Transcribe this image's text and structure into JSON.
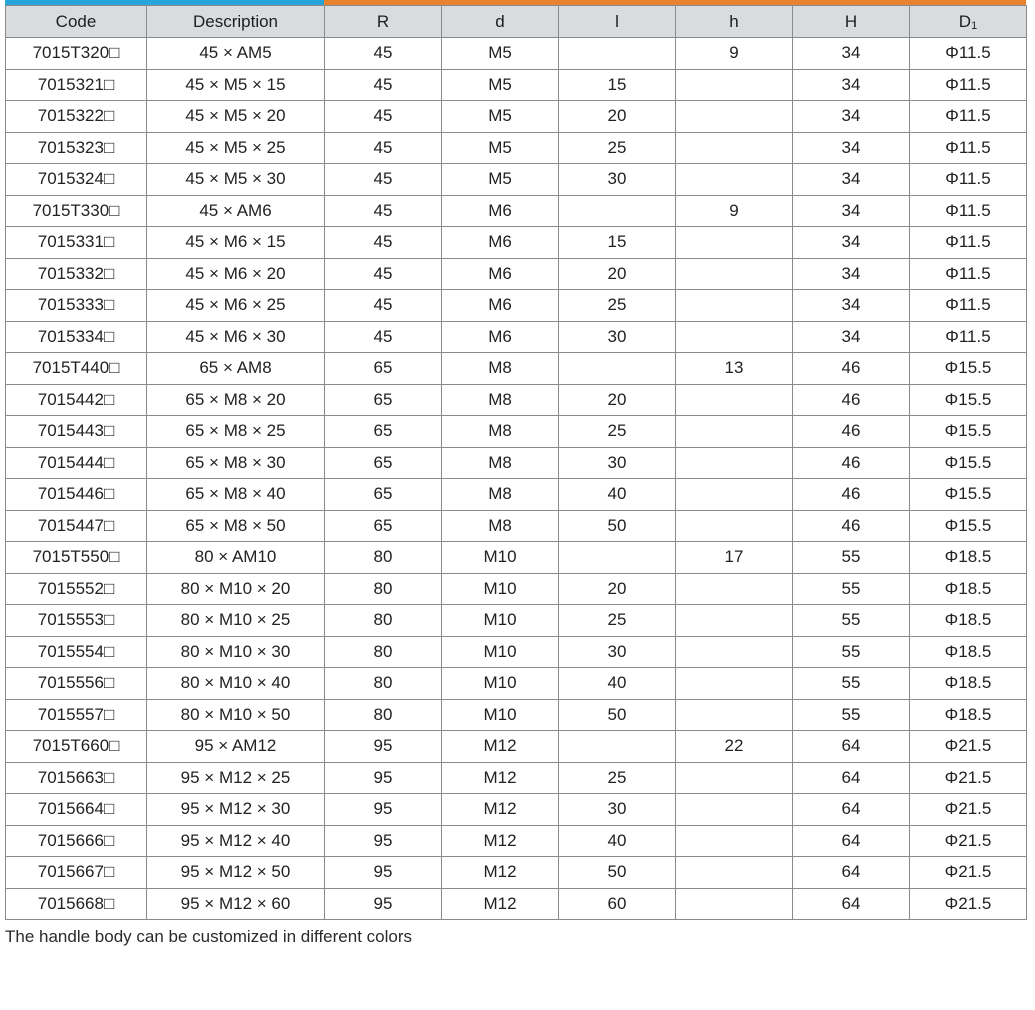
{
  "table": {
    "headers": [
      "Code",
      "Description",
      "R",
      "d",
      "l",
      "h",
      "H",
      "D"
    ],
    "header_subscript_d1": "1",
    "rows": [
      [
        "7015T320□",
        "45 × AM5",
        "45",
        "M5",
        "",
        "9",
        "34",
        "Φ11.5"
      ],
      [
        "7015321□",
        "45 × M5 × 15",
        "45",
        "M5",
        "15",
        "",
        "34",
        "Φ11.5"
      ],
      [
        "7015322□",
        "45 × M5 × 20",
        "45",
        "M5",
        "20",
        "",
        "34",
        "Φ11.5"
      ],
      [
        "7015323□",
        "45 × M5 × 25",
        "45",
        "M5",
        "25",
        "",
        "34",
        "Φ11.5"
      ],
      [
        "7015324□",
        "45 × M5 × 30",
        "45",
        "M5",
        "30",
        "",
        "34",
        "Φ11.5"
      ],
      [
        "7015T330□",
        "45 × AM6",
        "45",
        "M6",
        "",
        "9",
        "34",
        "Φ11.5"
      ],
      [
        "7015331□",
        "45 × M6 × 15",
        "45",
        "M6",
        "15",
        "",
        "34",
        "Φ11.5"
      ],
      [
        "7015332□",
        "45 × M6 × 20",
        "45",
        "M6",
        "20",
        "",
        "34",
        "Φ11.5"
      ],
      [
        "7015333□",
        "45 × M6 × 25",
        "45",
        "M6",
        "25",
        "",
        "34",
        "Φ11.5"
      ],
      [
        "7015334□",
        "45 × M6 × 30",
        "45",
        "M6",
        "30",
        "",
        "34",
        "Φ11.5"
      ],
      [
        "7015T440□",
        "65 × AM8",
        "65",
        "M8",
        "",
        "13",
        "46",
        "Φ15.5"
      ],
      [
        "7015442□",
        "65 × M8 × 20",
        "65",
        "M8",
        "20",
        "",
        "46",
        "Φ15.5"
      ],
      [
        "7015443□",
        "65 × M8 × 25",
        "65",
        "M8",
        "25",
        "",
        "46",
        "Φ15.5"
      ],
      [
        "7015444□",
        "65 × M8 × 30",
        "65",
        "M8",
        "30",
        "",
        "46",
        "Φ15.5"
      ],
      [
        "7015446□",
        "65 × M8 × 40",
        "65",
        "M8",
        "40",
        "",
        "46",
        "Φ15.5"
      ],
      [
        "7015447□",
        "65 × M8 × 50",
        "65",
        "M8",
        "50",
        "",
        "46",
        "Φ15.5"
      ],
      [
        "7015T550□",
        "80 × AM10",
        "80",
        "M10",
        "",
        "17",
        "55",
        "Φ18.5"
      ],
      [
        "7015552□",
        "80 × M10 × 20",
        "80",
        "M10",
        "20",
        "",
        "55",
        "Φ18.5"
      ],
      [
        "7015553□",
        "80 × M10 × 25",
        "80",
        "M10",
        "25",
        "",
        "55",
        "Φ18.5"
      ],
      [
        "7015554□",
        "80 × M10 × 30",
        "80",
        "M10",
        "30",
        "",
        "55",
        "Φ18.5"
      ],
      [
        "7015556□",
        "80 × M10 × 40",
        "80",
        "M10",
        "40",
        "",
        "55",
        "Φ18.5"
      ],
      [
        "7015557□",
        "80 × M10 × 50",
        "80",
        "M10",
        "50",
        "",
        "55",
        "Φ18.5"
      ],
      [
        "7015T660□",
        "95 × AM12",
        "95",
        "M12",
        "",
        "22",
        "64",
        "Φ21.5"
      ],
      [
        "7015663□",
        "95 × M12 × 25",
        "95",
        "M12",
        "25",
        "",
        "64",
        "Φ21.5"
      ],
      [
        "7015664□",
        "95 × M12 × 30",
        "95",
        "M12",
        "30",
        "",
        "64",
        "Φ21.5"
      ],
      [
        "7015666□",
        "95 × M12 × 40",
        "95",
        "M12",
        "40",
        "",
        "64",
        "Φ21.5"
      ],
      [
        "7015667□",
        "95 × M12 × 50",
        "95",
        "M12",
        "50",
        "",
        "64",
        "Φ21.5"
      ],
      [
        "7015668□",
        "95 × M12 × 60",
        "95",
        "M12",
        "60",
        "",
        "64",
        "Φ21.5"
      ]
    ]
  },
  "note": "The handle body can be customized in different colors",
  "colors": {
    "accent_blue": "#27a6de",
    "accent_orange": "#e8822f",
    "header_bg": "#d9dcdf",
    "border": "#8a8a8a"
  }
}
